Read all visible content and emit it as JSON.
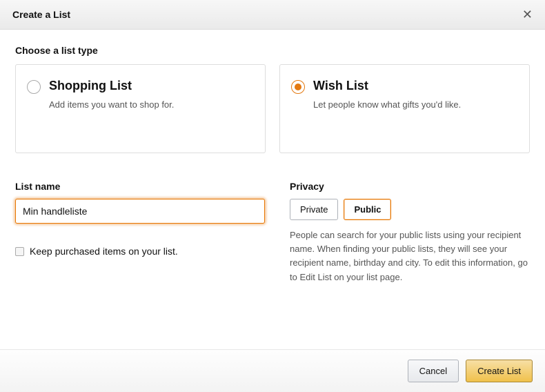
{
  "header": {
    "title": "Create a List"
  },
  "list_type": {
    "label": "Choose a list type",
    "options": {
      "shopping": {
        "title": "Shopping List",
        "desc": "Add items you want to shop for."
      },
      "wish": {
        "title": "Wish List",
        "desc": "Let people know what gifts you'd like."
      }
    },
    "selected": "wish"
  },
  "list_name": {
    "label": "List name",
    "value": "Min handleliste"
  },
  "keep_purchased": {
    "label": "Keep purchased items on your list.",
    "checked": false
  },
  "privacy": {
    "label": "Privacy",
    "private_label": "Private",
    "public_label": "Public",
    "selected": "public",
    "help_text": "People can search for your public lists using your recipient name. When finding your public lists, they will see your recipient name, birthday and city. To edit this information, go to Edit List on your list page."
  },
  "footer": {
    "cancel_label": "Cancel",
    "submit_label": "Create List"
  }
}
